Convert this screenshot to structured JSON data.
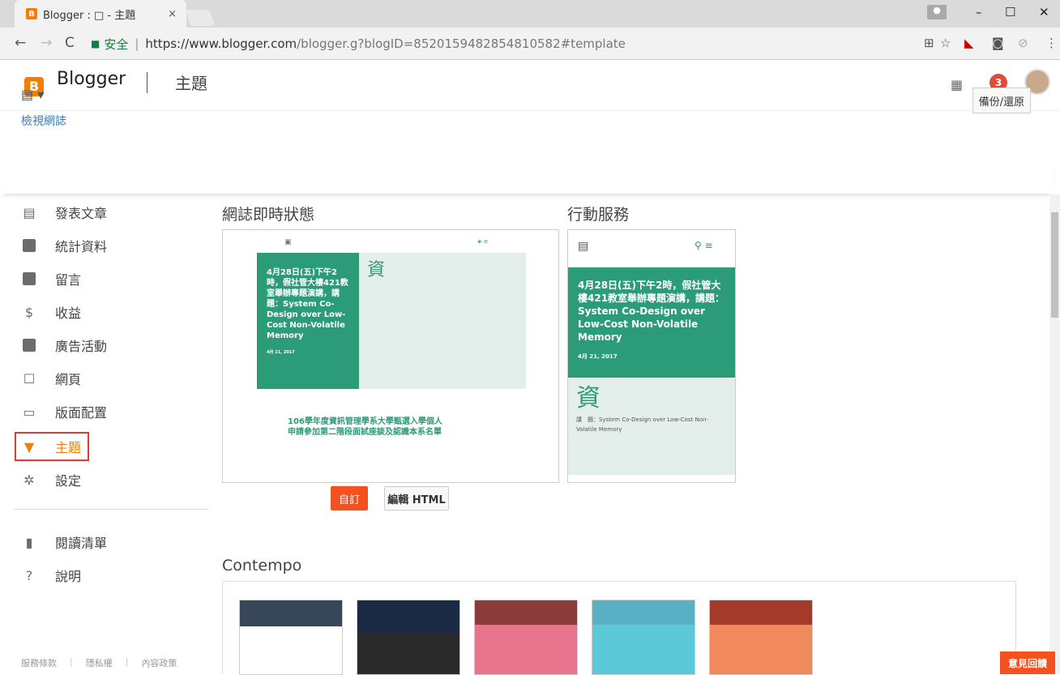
{
  "browser": {
    "tab_title": "Blogger : □ - 主題",
    "tab_close": "×",
    "secure_label": "安全",
    "url_host": "https://www.blogger.com",
    "url_path": "/blogger.g?blogID=8520159482854810582#template",
    "back": "←",
    "forward": "→",
    "reload": "C",
    "win_min": "–",
    "win_max": "☐",
    "win_close": "✕"
  },
  "header": {
    "logo_letter": "B",
    "app_name": "Blogger",
    "section": "主題",
    "notification_count": "3",
    "blog_selector": "▾",
    "view_blog": "檢視網誌",
    "backup_button": "備份/還原"
  },
  "sidebar": {
    "items": [
      {
        "label": "發表文章"
      },
      {
        "label": "統計資料"
      },
      {
        "label": "留言"
      },
      {
        "label": "收益"
      },
      {
        "label": "廣告活動"
      },
      {
        "label": "網頁"
      },
      {
        "label": "版面配置"
      },
      {
        "label": "主題"
      },
      {
        "label": "設定"
      }
    ],
    "secondary": [
      {
        "label": "閱讀清單"
      },
      {
        "label": "說明"
      }
    ],
    "footer": [
      "服務條款",
      "隱私權",
      "內容政策"
    ]
  },
  "main": {
    "live_title": "網誌即時狀態",
    "mobile_title": "行動服務",
    "customize_button": "自訂",
    "edit_html_button": "編輯 HTML",
    "gallery_title": "Contempo",
    "feedback_button": "意見回饋"
  },
  "preview": {
    "post_title": "4月28日(五)下午2時，假社管大樓421教室舉辦專題演講，講題：System Co-Design over Low-Cost Non-Volatile Memory",
    "post_date": "4月 21, 2017",
    "big_char": "資",
    "second_post": "106學年度資訊管理學系大學甄選入學個人申請參加第二階段面試座談及認識本系名單",
    "mobile_date": "4月 21, 2017",
    "mobile_body": "講　題：System Co-Design over Low-Cost Non-Volatile Memory"
  },
  "colors": {
    "accent": "#f57d00",
    "theme_green": "#2b9b78",
    "active_frame": "#e53935",
    "feedback": "#f4511e"
  }
}
